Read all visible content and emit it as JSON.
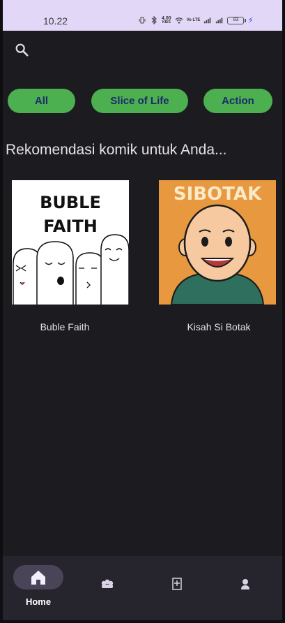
{
  "status_bar": {
    "time": "10.22",
    "speed": "4.00",
    "speed_unit": "KB/S",
    "network_label": "Vo LTE",
    "battery": "83"
  },
  "search": {
    "icon": "search-icon"
  },
  "chips": [
    {
      "label": "All"
    },
    {
      "label": "Slice of Life"
    },
    {
      "label": "Action"
    }
  ],
  "section": {
    "title": "Rekomendasi komik untuk Anda..."
  },
  "comics": [
    {
      "title": "Buble Faith",
      "cover_text": "BUBLE FAITH"
    },
    {
      "title": "Kisah Si Botak",
      "cover_text": "SIBOTAK"
    }
  ],
  "bottom_nav": {
    "items": [
      {
        "label": "Home",
        "icon": "home-icon"
      },
      {
        "icon": "categories-icon"
      },
      {
        "icon": "library-icon"
      },
      {
        "icon": "profile-icon"
      }
    ]
  },
  "colors": {
    "background": "#1c1b1f",
    "status_bar": "#e2d7f7",
    "chip": "#4caf50",
    "chip_text": "#1d2a6b",
    "nav_background": "#26242c",
    "nav_active_pill": "#4a4458"
  }
}
